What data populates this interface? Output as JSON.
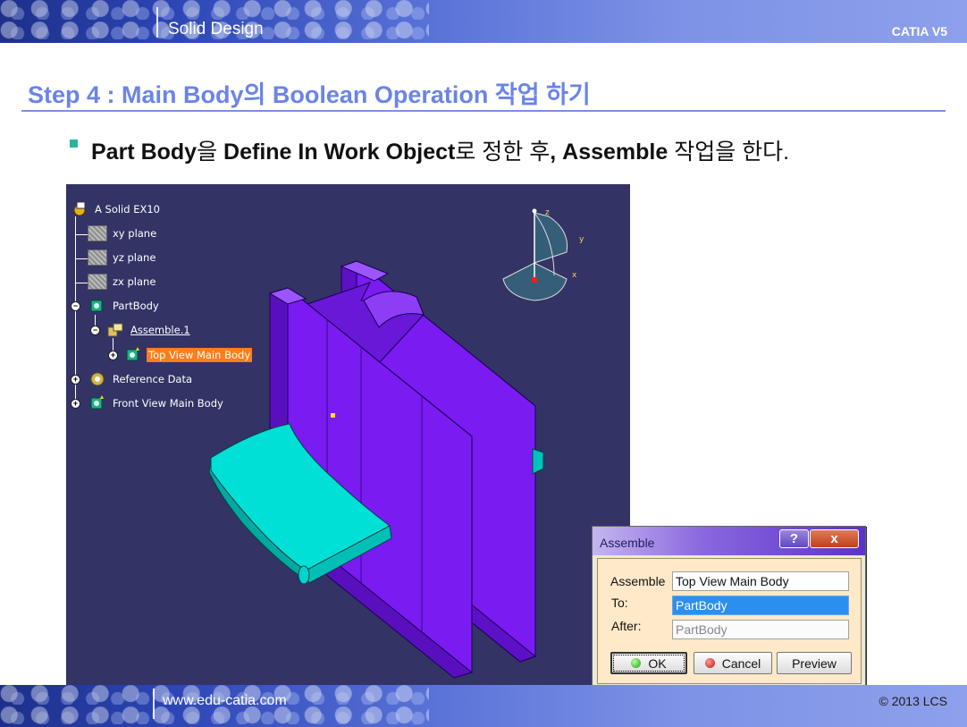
{
  "header": {
    "title": "Solid Design",
    "product": "CATIA V5"
  },
  "slide": {
    "title": "Step 4 : Main Body의 Boolean Operation 작업 하기",
    "bullet": {
      "part1": "Part Body",
      "part2": "을 ",
      "part3": "Define In Work Object",
      "part4": "로 정한 후",
      "part5": ", Assemble",
      "part6": " 작업을 한다."
    }
  },
  "tree": {
    "root": "A Solid EX10",
    "items": [
      {
        "label": "xy plane",
        "icon": "plane-icon"
      },
      {
        "label": "yz plane",
        "icon": "plane-icon"
      },
      {
        "label": "zx plane",
        "icon": "plane-icon"
      },
      {
        "label": "PartBody",
        "icon": "body-icon"
      },
      {
        "label": "Assemble.1",
        "icon": "assemble-icon"
      },
      {
        "label": "Top View Main Body",
        "icon": "body-icon",
        "selected": true
      },
      {
        "label": "Reference Data",
        "icon": "reference-icon"
      },
      {
        "label": "Front View Main Body",
        "icon": "body-icon"
      }
    ]
  },
  "compass": {
    "z": "z",
    "y": "y",
    "x": "x"
  },
  "dialog": {
    "title": "Assemble",
    "help_glyph": "?",
    "close_glyph": "x",
    "fields": {
      "assemble_label": "Assemble",
      "assemble_value": "Top View Main Body",
      "to_label": "To:",
      "to_value": "PartBody",
      "after_label": "After:",
      "after_value": "PartBody"
    },
    "buttons": {
      "ok": "OK",
      "cancel": "Cancel",
      "preview": "Preview"
    }
  },
  "footer": {
    "url": "www.edu-catia.com",
    "copyright": "© 2013 LCS"
  },
  "colors": {
    "accent": "#6b84e6",
    "viewport_bg": "#333366",
    "solid_body": "#7a1bf2",
    "tool_body": "#00d8d0",
    "tree_selected": "#ff7d1a"
  }
}
